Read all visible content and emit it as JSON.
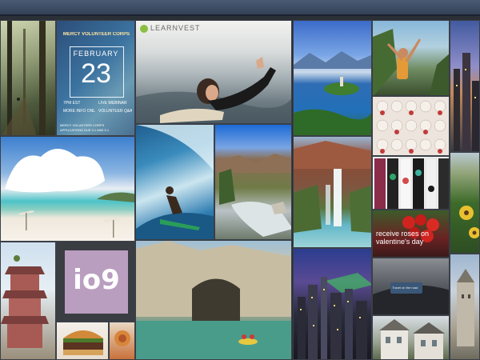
{
  "tiles": {
    "event_poster": {
      "org": "MERCY VOLUNTEER CORPS",
      "month": "FEBRUARY",
      "day": "23",
      "time_left": "7PM EST",
      "time_right": "LIVE WEBINAR",
      "info_left": "MORE INFO ONLINE",
      "info_right": "VOLUNTEER Q&A",
      "footer_line1": "MERCY VOLUNTEER CORPS",
      "footer_line2": "APPLICATIONS DUE 3.1 AND 5.1"
    },
    "learnvest": {
      "logo_text": "LEARNVEST"
    },
    "io9": {
      "logo_text": "io9"
    },
    "roses": {
      "caption": "receive roses on valentine's day"
    },
    "dashboard": {
      "label": "Travel on the road"
    }
  },
  "colors": {
    "background": "#2b2f36",
    "topbar": "#3f4f68",
    "io9_tile": "#b99ec0"
  }
}
